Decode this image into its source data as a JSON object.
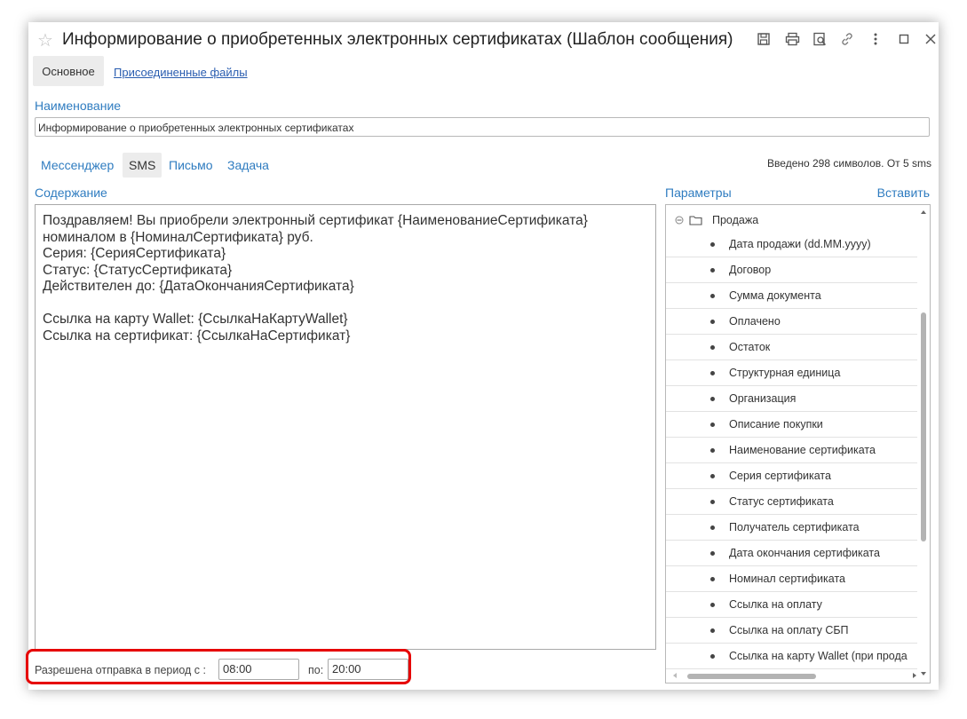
{
  "window": {
    "title": "Информирование о приобретенных электронных сертификатах (Шаблон сообщения)"
  },
  "tabs": [
    {
      "label": "Основное",
      "active": true
    },
    {
      "label": "Присоединенные файлы",
      "active": false
    }
  ],
  "name_field": {
    "label": "Наименование",
    "value": "Информирование о приобретенных электронных сертификатах"
  },
  "channels": [
    {
      "label": "Мессенджер"
    },
    {
      "label": "SMS",
      "active": true
    },
    {
      "label": "Письмо"
    },
    {
      "label": "Задача"
    }
  ],
  "counter_text": "Введено 298 символов. От 5 sms",
  "content": {
    "label": "Содержание",
    "text": "Поздравляем! Вы приобрели электронный сертификат {НаименованиеСертификата}\nноминалом в {НоминалСертификата} руб.\nСерия: {СерияСертификата}\nСтатус: {СтатусСертификата}\nДействителен до: {ДатаОкончанияСертификата}\n\nСсылка на карту Wallet: {СсылкаНаКартуWallet}\nСсылка на сертификат: {СсылкаНаСертификат}"
  },
  "params": {
    "label": "Параметры",
    "insert_label": "Вставить",
    "root": "Продажа",
    "items": [
      "Дата продажи (dd.MM.yyyy)",
      "Договор",
      "Сумма документа",
      "Оплачено",
      "Остаток",
      "Структурная единица",
      "Организация",
      "Описание покупки",
      "Наименование сертификата",
      "Серия сертификата",
      "Статус сертификата",
      "Получатель сертификата",
      "Дата окончания сертификата",
      "Номинал сертификата",
      "Ссылка на оплату",
      "Ссылка на оплату СБП",
      "Ссылка на карту Wallet (при прода"
    ]
  },
  "send_period": {
    "label": "Разрешена отправка в период с :",
    "from": "08:00",
    "to_label": "по:",
    "to": "20:00"
  },
  "colors": {
    "link": "#2f7cc0",
    "highlight": "#e60000"
  }
}
